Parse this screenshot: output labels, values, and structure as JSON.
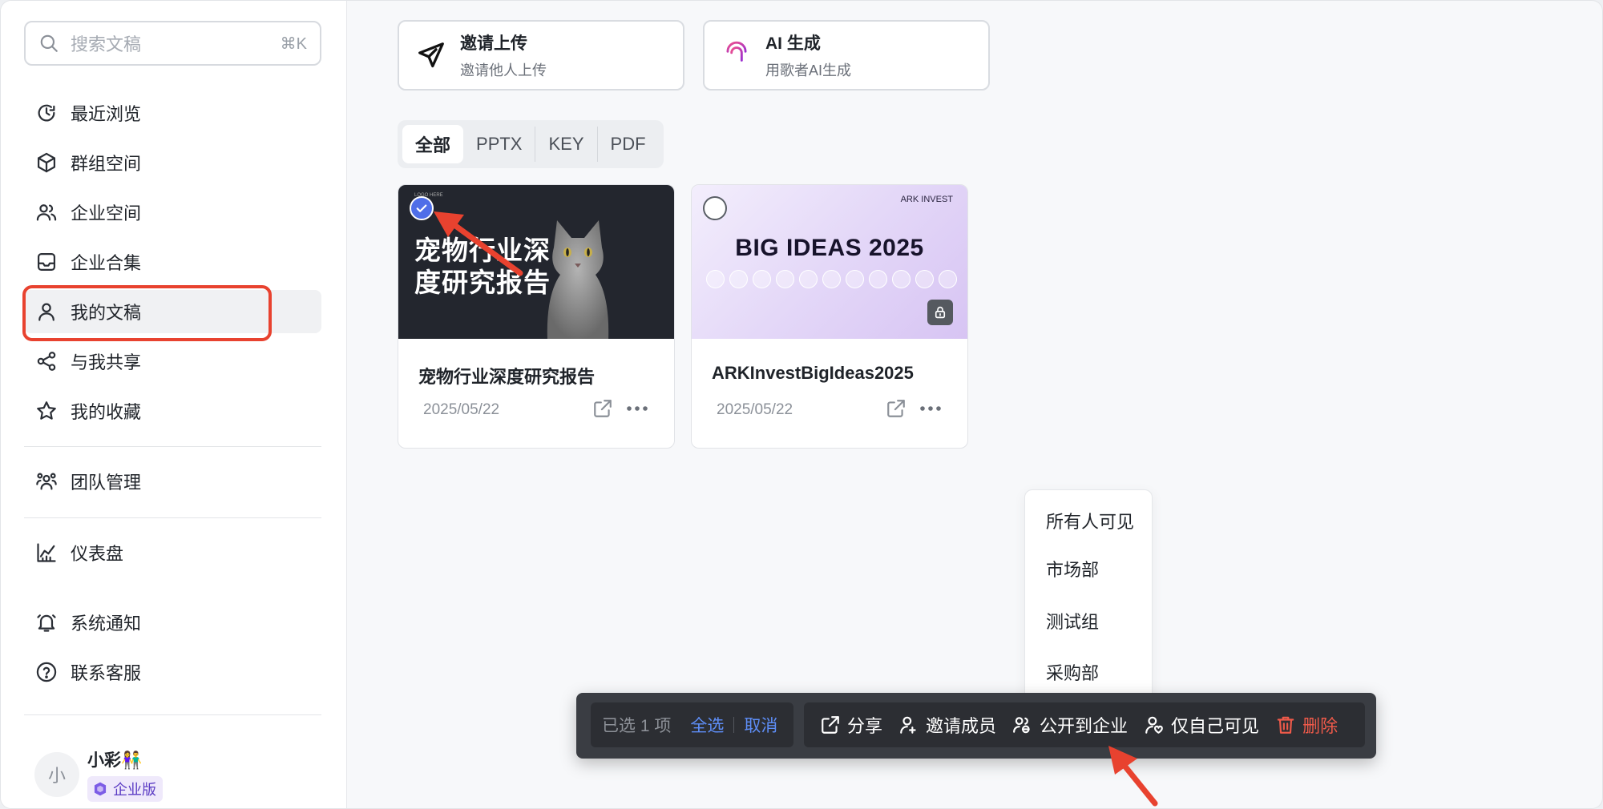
{
  "sidebar": {
    "search": {
      "placeholder": "搜索文稿",
      "shortcut": "⌘K"
    },
    "items": [
      {
        "label": "最近浏览",
        "icon": "recent-clock-icon"
      },
      {
        "label": "群组空间",
        "icon": "cube-icon"
      },
      {
        "label": "企业空间",
        "icon": "users-icon"
      },
      {
        "label": "企业合集",
        "icon": "inbox-icon"
      },
      {
        "label": "我的文稿",
        "icon": "user-icon",
        "active": true
      },
      {
        "label": "与我共享",
        "icon": "share-icon"
      },
      {
        "label": "我的收藏",
        "icon": "star-icon"
      },
      {
        "label": "团队管理",
        "icon": "team-icon"
      },
      {
        "label": "仪表盘",
        "icon": "chart-icon"
      },
      {
        "label": "系统通知",
        "icon": "bell-icon"
      },
      {
        "label": "联系客服",
        "icon": "help-icon"
      }
    ],
    "user": {
      "avatar": "小",
      "name": "小彩👫",
      "plan": "企业版"
    }
  },
  "main": {
    "actions": [
      {
        "title": "邀请上传",
        "subtitle": "邀请他人上传",
        "icon": "paper-plane-icon"
      },
      {
        "title": "AI 生成",
        "subtitle": "用歌者AI生成",
        "icon": "ai-fingerprint-icon"
      }
    ],
    "filters": [
      "全部",
      "PPTX",
      "KEY",
      "PDF"
    ],
    "active_filter": "全部",
    "documents": [
      {
        "name": "宠物行业深度研究报告",
        "date": "2025/05/22",
        "thumb_title_1": "宠物行业深",
        "thumb_title_2": "度研究报告",
        "thumb_logo": "LOGO HERE",
        "selected": true
      },
      {
        "name": "ARKInvestBigIdeas2025",
        "date": "2025/05/22",
        "thumb_title": "BIG IDEAS 2025",
        "thumb_brand": "ARK INVEST",
        "selected": false,
        "locked": true
      }
    ]
  },
  "dropdown": {
    "items": [
      "所有人可见",
      "市场部",
      "测试组",
      "采购部"
    ]
  },
  "selection_bar": {
    "count_text": "已选 1 项",
    "select_all": "全选",
    "cancel": "取消",
    "actions": [
      {
        "label": "分享",
        "icon": "external-share-icon"
      },
      {
        "label": "邀请成员",
        "icon": "add-user-icon"
      },
      {
        "label": "公开到企业",
        "icon": "group-public-icon"
      },
      {
        "label": "仅自己可见",
        "icon": "private-user-icon"
      },
      {
        "label": "删除",
        "icon": "trash-icon"
      }
    ]
  },
  "colors": {
    "accent": "#4f6ee8",
    "link": "#5e8ef7",
    "danger": "#ee5a4a",
    "highlight": "#e8422f",
    "bar_bg": "#3a3d43"
  }
}
